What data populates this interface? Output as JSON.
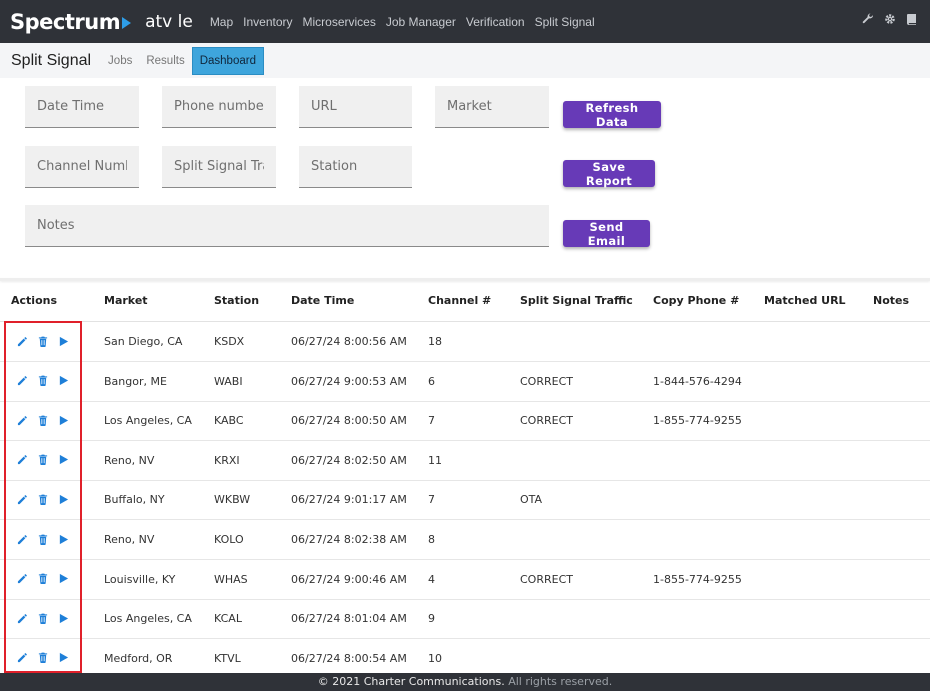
{
  "nav": {
    "brand": "Spectrum",
    "app_name": "atv le",
    "links": [
      "Map",
      "Inventory",
      "Microservices",
      "Job Manager",
      "Verification",
      "Split Signal"
    ],
    "icons": [
      "wrench-icon",
      "gear-icon",
      "book-icon"
    ]
  },
  "subheader": {
    "title": "Split Signal",
    "tabs": [
      "Jobs",
      "Results",
      "Dashboard"
    ],
    "active_tab": "Dashboard"
  },
  "form": {
    "date_time": {
      "placeholder": "Date Time",
      "value": ""
    },
    "phone_numbers": {
      "placeholder": "Phone numbers",
      "value": ""
    },
    "url": {
      "placeholder": "URL",
      "value": ""
    },
    "market": {
      "placeholder": "Market",
      "value": ""
    },
    "channel_number": {
      "placeholder": "Channel Number",
      "value": ""
    },
    "split_signal_traffic": {
      "placeholder": "Split Signal Traffic",
      "value": ""
    },
    "station": {
      "placeholder": "Station",
      "value": ""
    },
    "notes": {
      "placeholder": "Notes",
      "value": ""
    }
  },
  "buttons": {
    "refresh": "Refresh Data",
    "save": "Save Report",
    "email": "Send Email"
  },
  "table": {
    "headers": [
      "Actions",
      "Market",
      "Station",
      "Date Time",
      "Channel #",
      "Split Signal Traffic",
      "Copy Phone #",
      "Matched URL",
      "Notes"
    ],
    "rows": [
      {
        "market": "San Diego, CA",
        "station": "KSDX",
        "datetime": "06/27/24 8:00:56 AM",
        "channel": "18",
        "traffic": "",
        "phone": "",
        "url": "",
        "notes": ""
      },
      {
        "market": "Bangor, ME",
        "station": "WABI",
        "datetime": "06/27/24 9:00:53 AM",
        "channel": "6",
        "traffic": "CORRECT",
        "phone": "1-844-576-4294",
        "url": "",
        "notes": ""
      },
      {
        "market": "Los Angeles, CA",
        "station": "KABC",
        "datetime": "06/27/24 8:00:50 AM",
        "channel": "7",
        "traffic": "CORRECT",
        "phone": "1-855-774-9255",
        "url": "",
        "notes": ""
      },
      {
        "market": "Reno, NV",
        "station": "KRXI",
        "datetime": "06/27/24 8:02:50 AM",
        "channel": "11",
        "traffic": "",
        "phone": "",
        "url": "",
        "notes": ""
      },
      {
        "market": "Buffalo, NY",
        "station": "WKBW",
        "datetime": "06/27/24 9:01:17 AM",
        "channel": "7",
        "traffic": "OTA",
        "phone": "",
        "url": "",
        "notes": ""
      },
      {
        "market": "Reno, NV",
        "station": "KOLO",
        "datetime": "06/27/24 8:02:38 AM",
        "channel": "8",
        "traffic": "",
        "phone": "",
        "url": "",
        "notes": ""
      },
      {
        "market": "Louisville, KY",
        "station": "WHAS",
        "datetime": "06/27/24 9:00:46 AM",
        "channel": "4",
        "traffic": "CORRECT",
        "phone": "1-855-774-9255",
        "url": "",
        "notes": ""
      },
      {
        "market": "Los Angeles, CA",
        "station": "KCAL",
        "datetime": "06/27/24 8:01:04 AM",
        "channel": "9",
        "traffic": "",
        "phone": "",
        "url": "",
        "notes": ""
      },
      {
        "market": "Medford, OR",
        "station": "KTVL",
        "datetime": "06/27/24 8:00:54 AM",
        "channel": "10",
        "traffic": "",
        "phone": "",
        "url": "",
        "notes": ""
      }
    ]
  },
  "footer": {
    "copyright": "© 2021 Charter Communications.",
    "rights": " All rights reserved."
  },
  "colors": {
    "nav_bg": "#2f3238",
    "accent_purple": "#673ab7",
    "tab_active": "#3ea5dc",
    "action_icon": "#1e7fd8",
    "highlight": "#e0202a"
  }
}
